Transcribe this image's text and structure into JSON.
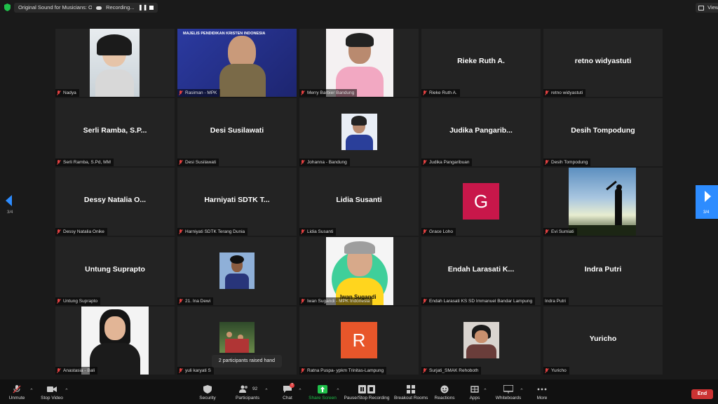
{
  "topbar": {
    "sound_label": "Original Sound for Musicians: Off",
    "recording_label": "Recording...",
    "view_label": "View"
  },
  "pager": {
    "left": "3/4",
    "right": "3/4"
  },
  "tiles": [
    {
      "name": "",
      "label": "Nadya",
      "video": "photo-nadya"
    },
    {
      "name": "",
      "label": "Rasiman - MPK",
      "video": "screen-share",
      "banner": "MAJELIS PENDIDIKAN KRISTEN INDONESIA"
    },
    {
      "name": "",
      "label": "Merry Barbier Bandung",
      "video": "photo-merry"
    },
    {
      "name": "Rieke Ruth A.",
      "label": "Rieke Ruth A."
    },
    {
      "name": "retno widyastuti",
      "label": "retno widyastuti"
    },
    {
      "name": "Serli Ramba, S.P...",
      "label": "Serli Ramba, S.Pd, MM"
    },
    {
      "name": "Desi Susilawati",
      "label": "Desi Susilawati"
    },
    {
      "name": "",
      "label": "Johanna - Bandung",
      "video": "photo-johanna"
    },
    {
      "name": "Judika Pangarib...",
      "label": "Judika Pangaribuan"
    },
    {
      "name": "Desih Tompodung",
      "label": "Desih Tompodung"
    },
    {
      "name": "Dessy Natalia O...",
      "label": "Dessy Natalia Onike"
    },
    {
      "name": "Harniyati SDTK T...",
      "label": "Harniyati SDTK Terang Dunia"
    },
    {
      "name": "Lidia Susanti",
      "label": "Lidia Susanti"
    },
    {
      "name": "",
      "label": "Grace Loho",
      "avatar_letter": "G",
      "avatar_color": "#c8174a"
    },
    {
      "name": "",
      "label": "Evi Sumiati",
      "video": "photo-sunrise"
    },
    {
      "name": "Untung Suprapto",
      "label": "Untung Suprapto"
    },
    {
      "name": "",
      "label": "21. Ina Dewi",
      "video": "photo-ina"
    },
    {
      "name": "",
      "label": "Iwan Sugandi - MPK Indonesia",
      "video": "photo-iwan",
      "caption": "Iwan Sugandi"
    },
    {
      "name": "Endah Larasati K...",
      "label": "Endah Larasati KS SD Immanuel Bandar Lampung"
    },
    {
      "name": "Indra Putri",
      "label": "Indra Putri"
    },
    {
      "name": "",
      "label": "Anastasia - Bali",
      "video": "photo-anastasia"
    },
    {
      "name": "",
      "label": "yuli karyati S",
      "video": "photo-yuli"
    },
    {
      "name": "",
      "label": "Ratna Puspa- ypkm Trinitas-Lampung",
      "avatar_letter": "R",
      "avatar_color": "#e8562a"
    },
    {
      "name": "",
      "label": "Surjati_SMAK Rehoboth",
      "video": "photo-surjati"
    },
    {
      "name": "Yuricho",
      "label": "Yuricho"
    }
  ],
  "tooltip": "2 participants raised hand",
  "toolbar": {
    "unmute": "Unmute",
    "stop_video": "Stop Video",
    "security": "Security",
    "participants": "Participants",
    "participants_count": "92",
    "chat": "Chat",
    "chat_badge": "7",
    "share_screen": "Share Screen",
    "record": "Pause/Stop Recording",
    "breakout": "Breakout Rooms",
    "reactions": "Reactions",
    "apps": "Apps",
    "whiteboards": "Whiteboards",
    "more": "More",
    "end": "End"
  },
  "colors": {
    "share_green": "#1fc04a",
    "end_red": "#cc3333",
    "mute_red": "#e14040"
  }
}
